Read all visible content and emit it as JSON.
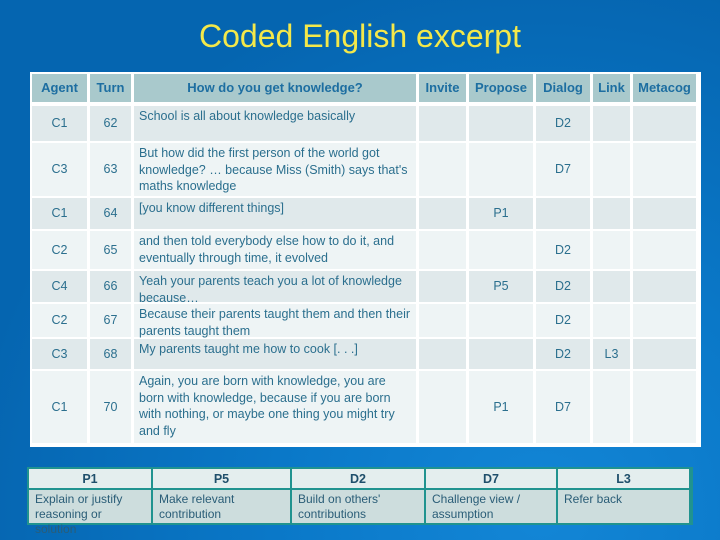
{
  "title": "Coded English excerpt",
  "table": {
    "headers": [
      "Agent",
      "Turn",
      "How do you get knowledge?",
      "Invite",
      "Propose",
      "Dialog",
      "Link",
      "Metacog"
    ],
    "rows": [
      {
        "agent": "C1",
        "turn": "62",
        "text": "School is all about knowledge basically",
        "invite": "",
        "propose": "",
        "dialog": "D2",
        "link": "",
        "metacog": ""
      },
      {
        "agent": "C3",
        "turn": "63",
        "text": "But how did the first person of the world got knowledge? … because Miss (Smith) says that's maths knowledge",
        "invite": "",
        "propose": "",
        "dialog": "D7",
        "link": "",
        "metacog": ""
      },
      {
        "agent": "C1",
        "turn": "64",
        "text": "[you know different things]",
        "invite": "",
        "propose": "P1",
        "dialog": "",
        "link": "",
        "metacog": ""
      },
      {
        "agent": "C2",
        "turn": "65",
        "text": "and then told everybody else how to do it, and eventually through time, it evolved",
        "invite": "",
        "propose": "",
        "dialog": "D2",
        "link": "",
        "metacog": ""
      },
      {
        "agent": "C4",
        "turn": "66",
        "text": "Yeah your parents teach you a lot of knowledge because…",
        "invite": "",
        "propose": "P5",
        "dialog": "D2",
        "link": "",
        "metacog": ""
      },
      {
        "agent": "C2",
        "turn": "67",
        "text": "Because their parents taught them and then their parents taught them",
        "invite": "",
        "propose": "",
        "dialog": "D2",
        "link": "",
        "metacog": ""
      },
      {
        "agent": "C3",
        "turn": "68",
        "text": "My parents taught me how to cook [. . .]",
        "invite": "",
        "propose": "",
        "dialog": "D2",
        "link": "L3",
        "metacog": ""
      },
      {
        "agent": "C1",
        "turn": "70",
        "text": "Again, you are born with knowledge, you are born with knowledge, because if you are born with nothing, or maybe one thing you might try and fly",
        "invite": "",
        "propose": "P1",
        "dialog": "D7",
        "link": "",
        "metacog": ""
      }
    ]
  },
  "legend": [
    {
      "code": "P1",
      "description": "Explain or justify reasoning or solution"
    },
    {
      "code": "P5",
      "description": "Make relevant contribution"
    },
    {
      "code": "D2",
      "description": "Build on others' contributions"
    },
    {
      "code": "D7",
      "description": "Challenge view / assumption"
    },
    {
      "code": "L3",
      "description": "Refer back"
    }
  ],
  "colors": {
    "background": "#0565b0",
    "title": "#f4e84a",
    "header_fill": "#a9c9cc",
    "header_text": "#1d6ea1",
    "row_odd": "#e0e9eb",
    "row_even": "#eef4f5",
    "legend_border": "#20938f"
  }
}
